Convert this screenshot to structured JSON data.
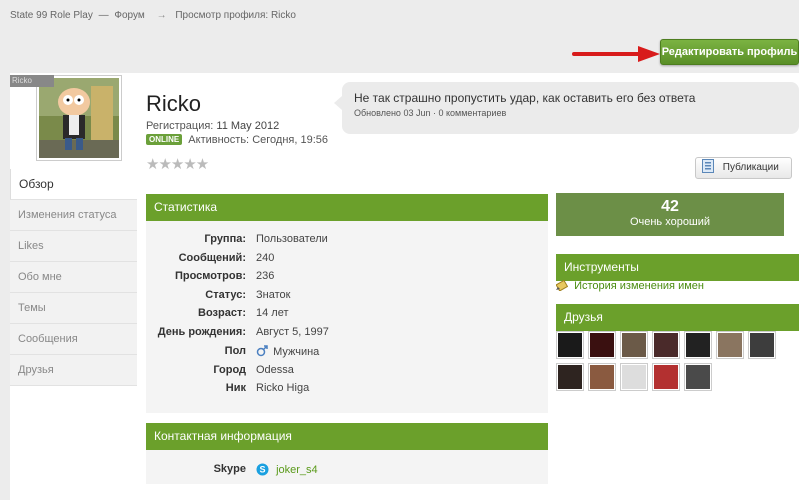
{
  "breadcrumb": {
    "items": [
      "State 99 Role Play",
      "—",
      "Форум"
    ],
    "separator": "→",
    "current": "Просмотр профиля: Ricko"
  },
  "toolbar": {
    "edit_profile_label": "Редактировать профиль"
  },
  "profile": {
    "name": "Ricko",
    "registration_label": "Регистрация:",
    "registration_date": "11 May 2012",
    "online_badge": "ONLINE",
    "activity_label": "Активность:",
    "activity_value": "Сегодня, 19:56",
    "rating_stars": "★★★★★",
    "rating": 0,
    "photo_tag": "Ricko"
  },
  "status": {
    "text": "Не так страшно пропустить удар, как оставить его без ответа",
    "updated": "Обновлено 03 Jun",
    "dot": "·",
    "comments": "0 комментариев"
  },
  "publications_button": "Публикации",
  "sidebar": {
    "items": [
      {
        "label": "Обзор",
        "active": true
      },
      {
        "label": "Изменения статуса"
      },
      {
        "label": "Likes"
      },
      {
        "label": "Обо мне"
      },
      {
        "label": "Темы"
      },
      {
        "label": "Сообщения"
      },
      {
        "label": "Друзья"
      }
    ]
  },
  "stats": {
    "title": "Статистика",
    "rows": [
      {
        "key": "Группа:",
        "value": "Пользователи"
      },
      {
        "key": "Сообщений:",
        "value": "240"
      },
      {
        "key": "Просмотров:",
        "value": "236"
      },
      {
        "key": "Статус:",
        "value": "Знаток"
      },
      {
        "key": "Возраст:",
        "value": "14 лет"
      },
      {
        "key": "День рождения:",
        "value": "Август 5, 1997"
      },
      {
        "key": "Пол",
        "value": "Мужчина"
      },
      {
        "key": "Город",
        "value": "Odessa"
      },
      {
        "key": "Ник",
        "value": "Ricko Higa"
      }
    ]
  },
  "contact": {
    "title": "Контактная информация",
    "skype_label": "Skype",
    "skype_value": "joker_s4"
  },
  "reputation": {
    "value": "42",
    "label": "Очень хороший"
  },
  "tools": {
    "title": "Инструменты",
    "name_history_link": "История изменения имен"
  },
  "friends": {
    "title": "Друзья",
    "avatar_colors": [
      "#1a1a1a",
      "#3a1010",
      "#6b5a48",
      "#4a2a2a",
      "#222222",
      "#8a7560",
      "#3d3d3d",
      "#2e2420",
      "#8a5a40",
      "#dddddd",
      "#b33030",
      "#4a4a4a"
    ]
  },
  "colors": {
    "accent": "#6ba02b",
    "link": "#4a8c10",
    "reputation_bg": "#6c8f47"
  }
}
